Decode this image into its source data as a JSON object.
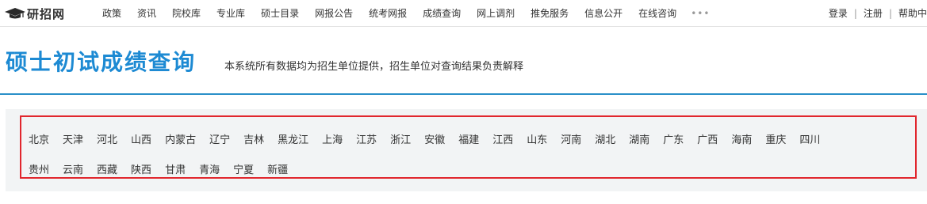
{
  "site": {
    "name": "研招网"
  },
  "nav": {
    "items": [
      "政策",
      "资讯",
      "院校库",
      "专业库",
      "硕士目录",
      "网报公告",
      "统考网报",
      "成绩查询",
      "网上调剂",
      "推免服务",
      "信息公开",
      "在线咨询"
    ],
    "more": "•••"
  },
  "user": {
    "login": "登录",
    "register": "注册",
    "help": "帮助中"
  },
  "page": {
    "title": "硕士初试成绩查询",
    "subtitle": "本系统所有数据均为招生单位提供，招生单位对查询结果负责解释"
  },
  "provinces": {
    "row1": [
      "北京",
      "天津",
      "河北",
      "山西",
      "内蒙古",
      "辽宁",
      "吉林",
      "黑龙江",
      "上海",
      "江苏",
      "浙江",
      "安徽",
      "福建",
      "江西",
      "山东",
      "河南",
      "湖北",
      "湖南",
      "广东",
      "广西",
      "海南",
      "重庆",
      "四川"
    ],
    "row2": [
      "贵州",
      "云南",
      "西藏",
      "陕西",
      "甘肃",
      "青海",
      "宁夏",
      "新疆"
    ]
  },
  "colors": {
    "accent": "#1d8ad3",
    "highlight": "#e1262d",
    "panel": "#f2f4f5"
  }
}
